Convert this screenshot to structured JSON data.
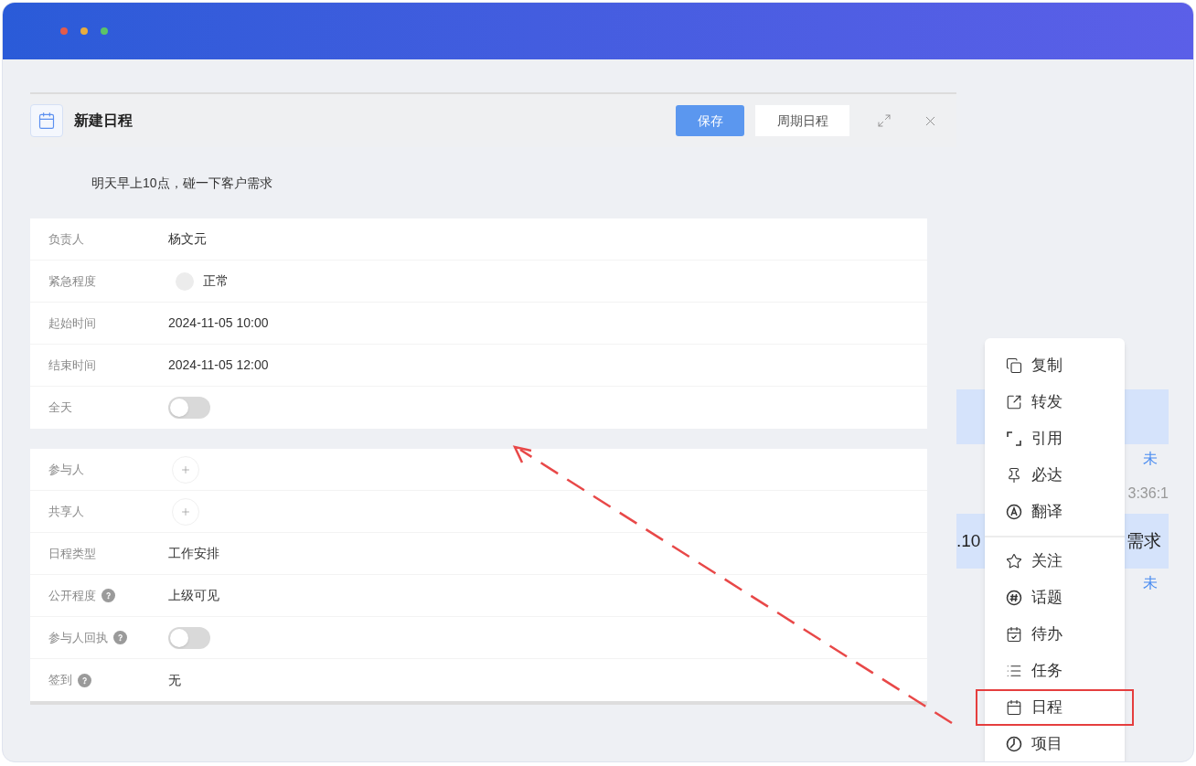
{
  "browser": {
    "dots": [
      {
        "color": "#e35b4b"
      },
      {
        "color": "#e8ad3e"
      },
      {
        "color": "#5cc368"
      }
    ]
  },
  "dialog": {
    "title": "新建日程",
    "actions": [
      {
        "kind": "primary",
        "label": "保存"
      },
      {
        "kind": "secondary",
        "label": "周期日程"
      }
    ],
    "subject": "明天早上10点，碰一下客户需求",
    "sections": [
      {
        "rows": [
          {
            "kind": "text",
            "label": "负责人",
            "help": false,
            "value": "杨文元"
          },
          {
            "kind": "priority",
            "label": "紧急程度",
            "help": false,
            "value": "正常"
          },
          {
            "kind": "text",
            "label": "起始时间",
            "help": false,
            "value": "2024-11-05 10:00"
          },
          {
            "kind": "text",
            "label": "结束时间",
            "help": false,
            "value": "2024-11-05 12:00"
          },
          {
            "kind": "toggle",
            "label": "全天",
            "help": false,
            "on": false
          }
        ]
      },
      {
        "rows": [
          {
            "kind": "add",
            "label": "参与人",
            "help": false
          },
          {
            "kind": "add",
            "label": "共享人",
            "help": false
          },
          {
            "kind": "text",
            "label": "日程类型",
            "help": false,
            "value": "工作安排"
          },
          {
            "kind": "text",
            "label": "公开程度",
            "help": true,
            "value": "上级可见"
          },
          {
            "kind": "toggle",
            "label": "参与人回执",
            "help": true,
            "on": false
          },
          {
            "kind": "text",
            "label": "签到",
            "help": true,
            "value": "无"
          }
        ]
      }
    ]
  },
  "chat": {
    "items": [
      {
        "kind": "bubble"
      },
      {
        "kind": "status",
        "label": "未"
      },
      {
        "kind": "time",
        "label": "3:36:1"
      },
      {
        "kind": "bubble",
        "start": ".10",
        "end": "需求"
      },
      {
        "kind": "status",
        "label": "未"
      }
    ]
  },
  "context_menu": {
    "groups": [
      {
        "items": [
          {
            "label": "复制",
            "highlighted": false
          },
          {
            "label": "转发",
            "highlighted": false
          },
          {
            "label": "引用",
            "highlighted": false
          },
          {
            "label": "必达",
            "highlighted": false
          },
          {
            "label": "翻译",
            "highlighted": false
          }
        ]
      },
      {
        "items": [
          {
            "label": "关注",
            "highlighted": false
          },
          {
            "label": "话题",
            "highlighted": false
          },
          {
            "label": "待办",
            "highlighted": false
          },
          {
            "label": "任务",
            "highlighted": false
          },
          {
            "label": "日程",
            "highlighted": true
          },
          {
            "label": "项目",
            "highlighted": false
          }
        ]
      }
    ]
  }
}
